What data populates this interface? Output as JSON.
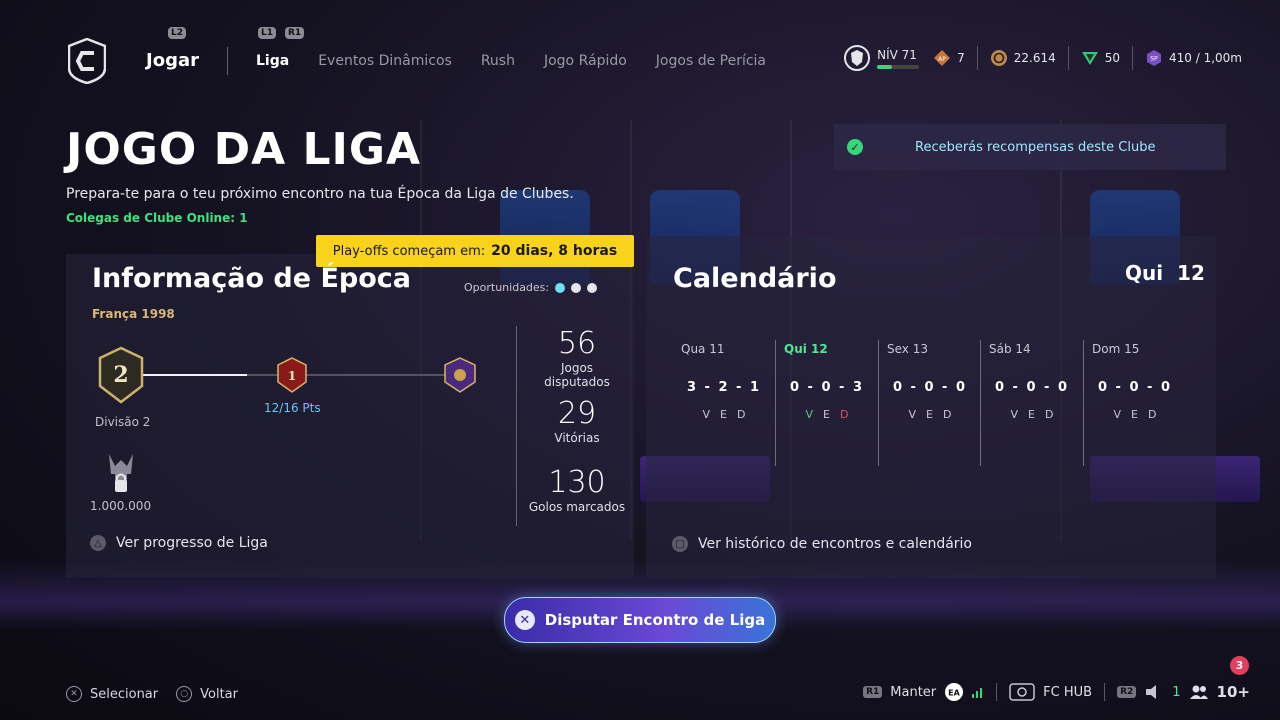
{
  "nav": {
    "l2_hint": "L2",
    "l1_hint": "L1",
    "r1_hint": "R1",
    "primary": "Jogar",
    "tabs": [
      "Liga",
      "Eventos Dinâmicos",
      "Rush",
      "Jogo Rápido",
      "Jogos de Perícia"
    ],
    "active_tab": "Liga"
  },
  "stats": {
    "level": "NÍV 71",
    "level_progress": 0.35,
    "ap": "7",
    "ap_icon": "AP",
    "coins": "22.614",
    "points": "50",
    "sp_icon": "SP",
    "season_points": "410 / 1,00m"
  },
  "toast": {
    "text": "Receberás recompensas deste Clube"
  },
  "header": {
    "title": "JOGO DA LIGA",
    "subtitle": "Prepara-te para o teu próximo encontro na tua Época da Liga de Clubes.",
    "online": "Colegas de Clube Online: 1"
  },
  "playoffs": {
    "label": "Play-offs começam em:",
    "value": "20 dias, 8 horas"
  },
  "season": {
    "title": "Informação de Época",
    "name": "França 1998",
    "opportunities_label": "Oportunidades:",
    "division_badge": "2",
    "division_label": "Divisão 2",
    "next_badge": "1",
    "points": "12/16 Pts",
    "reward_value": "1.000.000",
    "progress": 0.34,
    "stats": [
      {
        "value": "56",
        "label": "Jogos disputados"
      },
      {
        "value": "29",
        "label": "Vitórias"
      },
      {
        "value": "130",
        "label": "Golos marcados"
      }
    ],
    "action": "Ver progresso de Liga"
  },
  "calendar": {
    "title": "Calendário",
    "today_day": "Qui",
    "today_num": "12",
    "days": [
      {
        "day": "Qua 11",
        "score": "3 - 2 - 1",
        "v": "V",
        "e": "E",
        "d": "D"
      },
      {
        "day": "Qui 12",
        "score": "0 - 0 - 3",
        "v": "V",
        "e": "E",
        "d": "D"
      },
      {
        "day": "Sex 13",
        "score": "0 - 0 - 0",
        "v": "V",
        "e": "E",
        "d": "D"
      },
      {
        "day": "Sáb 14",
        "score": "0 - 0 - 0",
        "v": "V",
        "e": "E",
        "d": "D"
      },
      {
        "day": "Dom 15",
        "score": "0 - 0 - 0",
        "v": "V",
        "e": "E",
        "d": "D"
      }
    ],
    "action": "Ver histórico de encontros e calendário"
  },
  "cta": {
    "label": "Disputar Encontro de Liga"
  },
  "footer": {
    "select": "Selecionar",
    "back": "Voltar",
    "r1_hint": "R1",
    "hold": "Manter",
    "hub": "FC HUB",
    "r2_hint": "R2",
    "voice_count": "1",
    "friends": "10+",
    "notifications": "3"
  },
  "colors": {
    "accent_yellow": "#f8d21b",
    "online_green": "#42e07d",
    "cta_blue": "#3a2ca8"
  }
}
